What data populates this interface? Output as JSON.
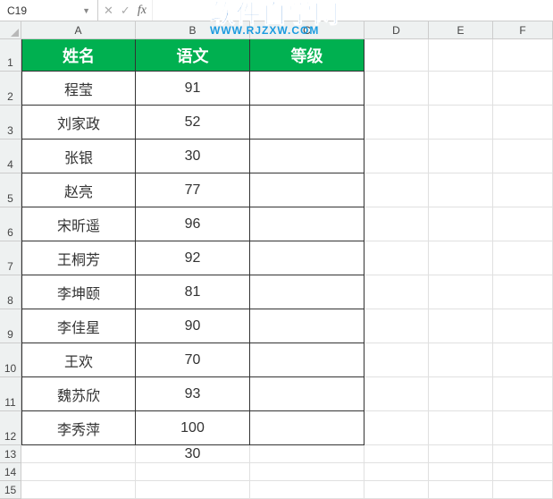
{
  "namebox": {
    "value": "C19"
  },
  "formula": {
    "value": ""
  },
  "columns": {
    "A": "A",
    "B": "B",
    "C": "C",
    "D": "D",
    "E": "E",
    "F": "F"
  },
  "rows": [
    "1",
    "2",
    "3",
    "4",
    "5",
    "6",
    "7",
    "8",
    "9",
    "10",
    "11",
    "12",
    "13",
    "14",
    "15"
  ],
  "header": {
    "name": "姓名",
    "chinese": "语文",
    "grade": "等级"
  },
  "data": [
    {
      "name": "程莹",
      "chinese": "91",
      "grade": ""
    },
    {
      "name": "刘家政",
      "chinese": "52",
      "grade": ""
    },
    {
      "name": "张银",
      "chinese": "30",
      "grade": ""
    },
    {
      "name": "赵亮",
      "chinese": "77",
      "grade": ""
    },
    {
      "name": "宋昕遥",
      "chinese": "96",
      "grade": ""
    },
    {
      "name": "王桐芳",
      "chinese": "92",
      "grade": ""
    },
    {
      "name": "李坤颐",
      "chinese": "81",
      "grade": ""
    },
    {
      "name": "李佳星",
      "chinese": "90",
      "grade": ""
    },
    {
      "name": "王欢",
      "chinese": "70",
      "grade": ""
    },
    {
      "name": "魏苏欣",
      "chinese": "93",
      "grade": ""
    },
    {
      "name": "李秀萍",
      "chinese": "100",
      "grade": ""
    }
  ],
  "extra": {
    "b13": "30"
  },
  "watermark": {
    "main": "软件自学网",
    "sub": "WWW.RJZXW.COM"
  }
}
